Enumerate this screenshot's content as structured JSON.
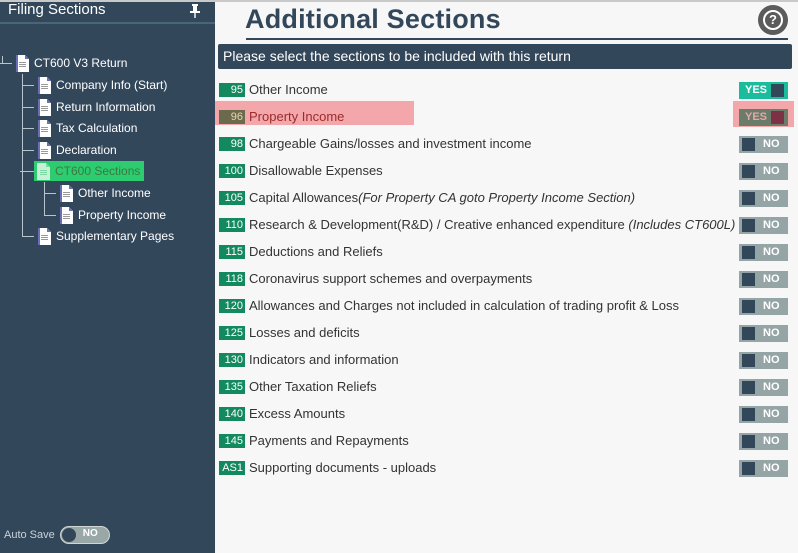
{
  "sidebar": {
    "title": "Filing Sections",
    "tree": {
      "root": "CT600 V3 Return",
      "children": [
        {
          "label": "Company Info (Start)"
        },
        {
          "label": "Return Information"
        },
        {
          "label": "Tax Calculation"
        },
        {
          "label": "Declaration"
        },
        {
          "label": "CT600 Sections",
          "selected": true,
          "children": [
            {
              "label": "Other Income"
            },
            {
              "label": "Property Income"
            }
          ]
        },
        {
          "label": "Supplementary Pages"
        }
      ]
    },
    "auto_save": {
      "label": "Auto Save",
      "value": "NO"
    }
  },
  "main": {
    "title": "Additional Sections",
    "banner": "Please select the sections to be included with this return",
    "help_icon": "question-circle-icon",
    "colors": {
      "code_badge": "#13895f",
      "toggle_yes": "#1abc9c",
      "toggle_no": "#95a5a6",
      "highlight": "#f4a7ab",
      "primary": "#33475b"
    },
    "sections": [
      {
        "code": "95",
        "label": "Other Income",
        "note": "",
        "value": "YES",
        "flagged": false
      },
      {
        "code": "96",
        "label": "Property Income",
        "note": "",
        "value": "YES",
        "flagged": true
      },
      {
        "code": "98",
        "label": "Chargeable Gains/losses and investment income",
        "note": "",
        "value": "NO",
        "flagged": false
      },
      {
        "code": "100",
        "label": "Disallowable Expenses",
        "note": "",
        "value": "NO",
        "flagged": false
      },
      {
        "code": "105",
        "label": "Capital Allowances",
        "note": "(For Property CA goto Property Income Section)",
        "value": "NO",
        "flagged": false
      },
      {
        "code": "110",
        "label": "Research & Development(R&D) / Creative enhanced expenditure ",
        "note": "(Includes CT600L)",
        "value": "NO",
        "flagged": false
      },
      {
        "code": "115",
        "label": "Deductions and Reliefs",
        "note": "",
        "value": "NO",
        "flagged": false
      },
      {
        "code": "118",
        "label": "Coronavirus support schemes and overpayments",
        "note": "",
        "value": "NO",
        "flagged": false
      },
      {
        "code": "120",
        "label": "Allowances and Charges not included in calculation of trading profit & Loss",
        "note": "",
        "value": "NO",
        "flagged": false
      },
      {
        "code": "125",
        "label": "Losses and deficits",
        "note": "",
        "value": "NO",
        "flagged": false
      },
      {
        "code": "130",
        "label": "Indicators and information",
        "note": "",
        "value": "NO",
        "flagged": false
      },
      {
        "code": "135",
        "label": "Other Taxation Reliefs",
        "note": "",
        "value": "NO",
        "flagged": false
      },
      {
        "code": "140",
        "label": "Excess Amounts",
        "note": "",
        "value": "NO",
        "flagged": false
      },
      {
        "code": "145",
        "label": "Payments and Repayments",
        "note": "",
        "value": "NO",
        "flagged": false
      },
      {
        "code": "AS1",
        "label": "Supporting documents - uploads",
        "note": "",
        "value": "NO",
        "flagged": false
      }
    ]
  }
}
